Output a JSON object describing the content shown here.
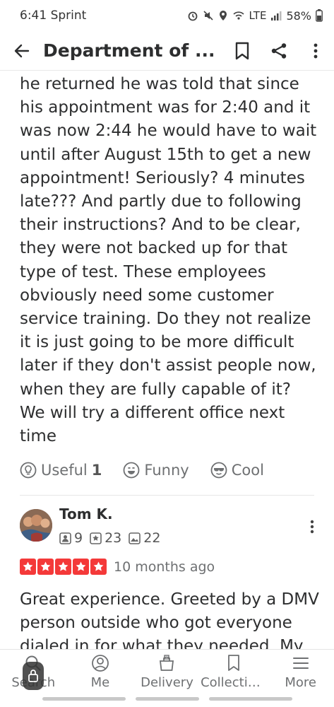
{
  "status_bar": {
    "time": "6:41",
    "carrier": "Sprint",
    "network": "LTE",
    "battery": "58%"
  },
  "app_bar": {
    "title": "Department of ..."
  },
  "review": {
    "lines": [
      "he returned he was told that since",
      "his appointment was for 2:40 and it",
      "was now 2:44 he would have to wait",
      "until after August 15th to get a new",
      "appointment!  Seriously? 4 minutes",
      "late??? And partly due to following",
      "their instructions?  And to be clear,",
      "they were not backed up for that",
      "type of test.  These employees",
      "obviously need some customer",
      "service training.  Do they not realize",
      "it is just going to be more difficult",
      "later if they don't assist people now,",
      "when they are fully capable of it?",
      "We will try a different office next",
      "time"
    ],
    "reactions": {
      "useful_label": "Useful",
      "useful_count": "1",
      "funny_label": "Funny",
      "cool_label": "Cool"
    }
  },
  "next_review": {
    "reviewer_name": "Tom K.",
    "friends": "9",
    "reviews": "23",
    "photos": "22",
    "rating": 5,
    "date": "10 months ago",
    "lines": [
      "Great experience. Greeted by a DMV",
      "person outside who got everyone",
      "dialed in for what they needed.  My"
    ]
  },
  "bottom_nav": {
    "search": "Search",
    "me": "Me",
    "delivery": "Delivery",
    "collections": "Collectio...",
    "more": "More"
  },
  "colors": {
    "star_red": "#f43939",
    "text": "#2d2e2f",
    "muted": "#6e7072"
  }
}
